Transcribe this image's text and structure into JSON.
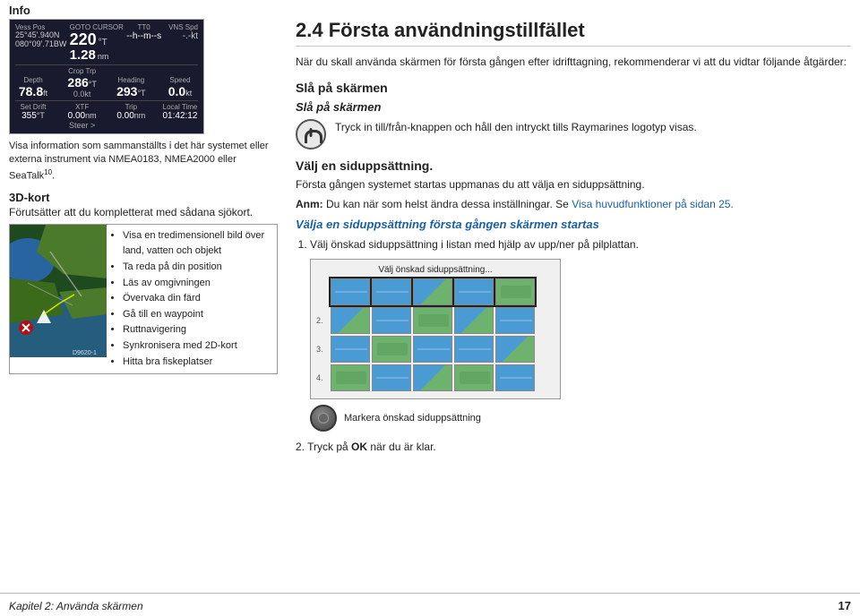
{
  "page": {
    "title": "Info",
    "footer_left": "Kapitel 2: Använda skärmen",
    "footer_right": "17"
  },
  "left": {
    "device": {
      "vess_pos": "Vess Pos",
      "coords": "25°45'.940N\n080°09'.71BW",
      "goto_cursor": "GOTO CURSOR",
      "tt0_label": "TT0",
      "vns_spd_label": "VNS Spd",
      "val_220": "220",
      "unit_T1": "°T",
      "val_128": "1.28",
      "unit_nm": "nm",
      "val_dashes": "--h--m--s",
      "val_kt": "-.-kt",
      "depth_label": "Depth",
      "crop_trp_label": "Crop Trp",
      "heading_label": "Heading",
      "speed_label": "Speed",
      "depth_val": "78.8",
      "depth_unit": "ft",
      "crop_val": "286",
      "crop_unit": "°T",
      "crop_dec": "0.0kt",
      "heading_val": "293",
      "heading_unit": "°T",
      "speed_val": "0.0",
      "speed_unit": "kt",
      "set_drift_label": "Set Drift",
      "xtf_label": "XTF",
      "trip_label": "Trip",
      "local_time_label": "Local Time",
      "set_drift_val": "355",
      "set_drift_unit": "°T",
      "xtf_val": "0.00",
      "xtf_unit": "nm",
      "steer": "Steer >",
      "trip_val": "0.00",
      "trip_unit": "nm",
      "local_time": "01:42:12"
    },
    "device_note": "Visa information som sammanställts i det här systemet eller externa instrument via NMEA0183, NMEA2000 eller SeaTalk",
    "device_note_sup": "10",
    "section_3d_title": "3D-kort",
    "section_3d_sub": "Förutsätter att du kompletterat med sådana sjökort.",
    "features": [
      "Visa en tredimensionell bild över land, vatten och objekt",
      "Ta reda på din position",
      "Läs av omgivningen",
      "Övervaka din färd",
      "Gå till en waypoint",
      "Ruttnavigering",
      "Synkronisera med 2D-kort",
      "Hitta bra fiskeplatser"
    ],
    "map_id": "D9620-1"
  },
  "right": {
    "section_header": "2.4 Första användningstillfället",
    "intro_text": "När du skall använda skärmen för första gången efter idrifttagning, rekommenderar vi att du vidtar följande åtgärder:",
    "slaa_title": "Slå på skärmen",
    "slaa_italic": "Slå på skärmen",
    "power_desc": "Tryck in till/från-knappen och håll den intryckt tills Raymarines logotyp visas.",
    "valj_title": "Välj en siduppsättning.",
    "valj_desc1": "Första gången systemet startas uppmanas du att välja en siduppsättning.",
    "anm_label": "Anm:",
    "anm_text": "Du kan när som helst ändra dessa inställningar. Se",
    "anm_link": "Visa huvudfunktioner på sidan 25.",
    "italic_section": "Välja en siduppsättning första gången skärmen startas",
    "step1_text": "Välj önskad siduppsättning i listan med hjälp av upp/ner på pilplattan.",
    "screen_header": "Välj önskad siduppsättning...",
    "screen_rows": [
      {
        "num": "",
        "cells": [
          "water",
          "water",
          "mixed",
          "water",
          "land"
        ]
      },
      {
        "num": "2.",
        "cells": [
          "mixed",
          "water",
          "land",
          "mixed",
          "water"
        ]
      },
      {
        "num": "3.",
        "cells": [
          "water",
          "land",
          "water",
          "water",
          "mixed"
        ]
      },
      {
        "num": "4.",
        "cells": [
          "land",
          "water",
          "mixed",
          "land",
          "water"
        ]
      }
    ],
    "scroll_label": "Markera önskad\nsiduppsättning",
    "step2_text": "Tryck på",
    "step2_bold": "OK",
    "step2_rest": "när du är klar."
  }
}
